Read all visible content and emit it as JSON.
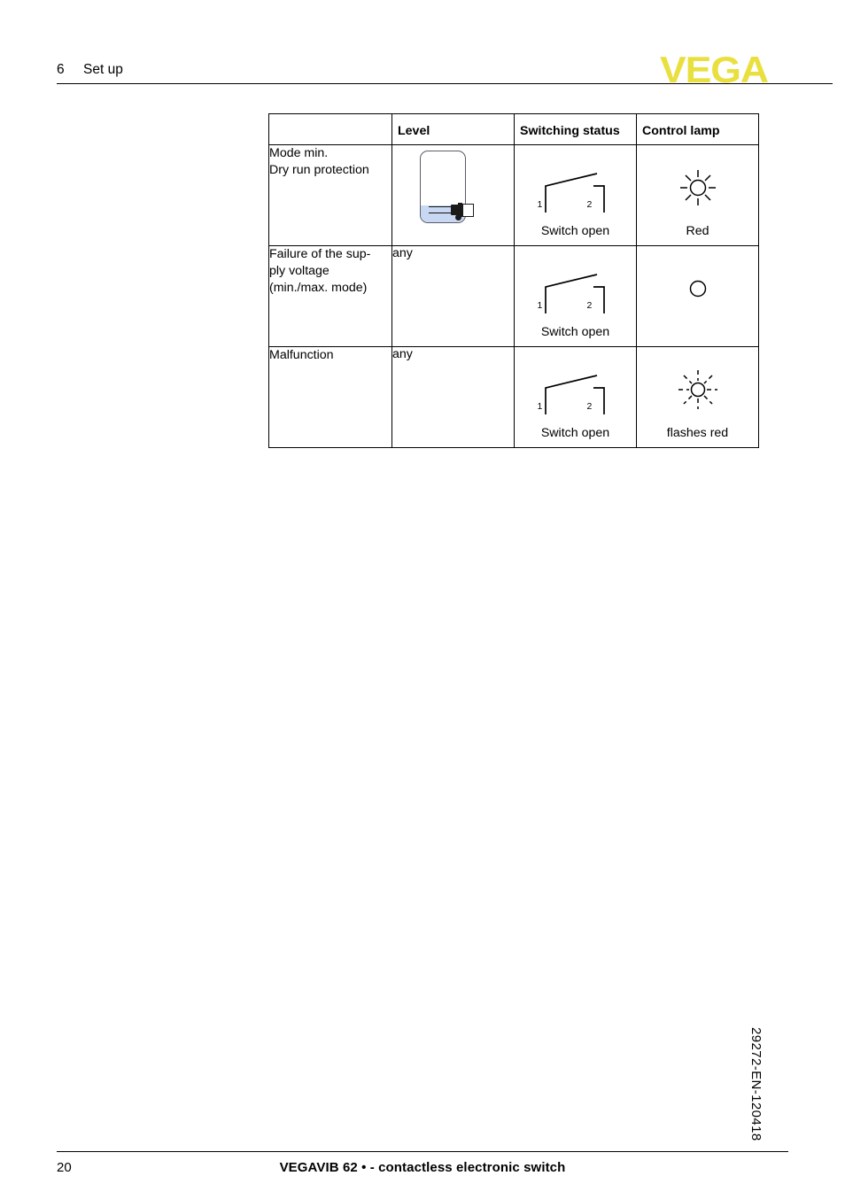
{
  "header": {
    "chapter_number": "6",
    "chapter_title": "Set up",
    "logo_text": "VEGA",
    "logo_color": "#e9e03f"
  },
  "table": {
    "columns": [
      "",
      "Level",
      "Switching status",
      "Control lamp"
    ],
    "rows": [
      {
        "description_lines": [
          "Mode min.",
          "Dry run protection"
        ],
        "level_type": "tank-graphic",
        "level_text": "",
        "switch_state": "open",
        "switch_terminal_1": "1",
        "switch_terminal_2": "2",
        "switch_caption": "Switch open",
        "lamp_state": "on",
        "lamp_caption": "Red"
      },
      {
        "description_lines": [
          "Failure of the sup-",
          "ply voltage",
          "(min./max. mode)"
        ],
        "level_type": "text",
        "level_text": "any",
        "switch_state": "open",
        "switch_terminal_1": "1",
        "switch_terminal_2": "2",
        "switch_caption": "Switch open",
        "lamp_state": "off",
        "lamp_caption": ""
      },
      {
        "description_lines": [
          "Malfunction"
        ],
        "level_type": "text",
        "level_text": "any",
        "switch_state": "open",
        "switch_terminal_1": "1",
        "switch_terminal_2": "2",
        "switch_caption": "Switch open",
        "lamp_state": "flashing",
        "lamp_caption": "flashes red"
      }
    ]
  },
  "graphics": {
    "tank_liquid_color": "#c9d8f2",
    "tank_outline_color": "#5b5b6b",
    "line_color": "#000000"
  },
  "footer": {
    "page_number": "20",
    "title": "VEGAVIB 62 • - contactless electronic switch",
    "document_id": "29272-EN-120418"
  }
}
